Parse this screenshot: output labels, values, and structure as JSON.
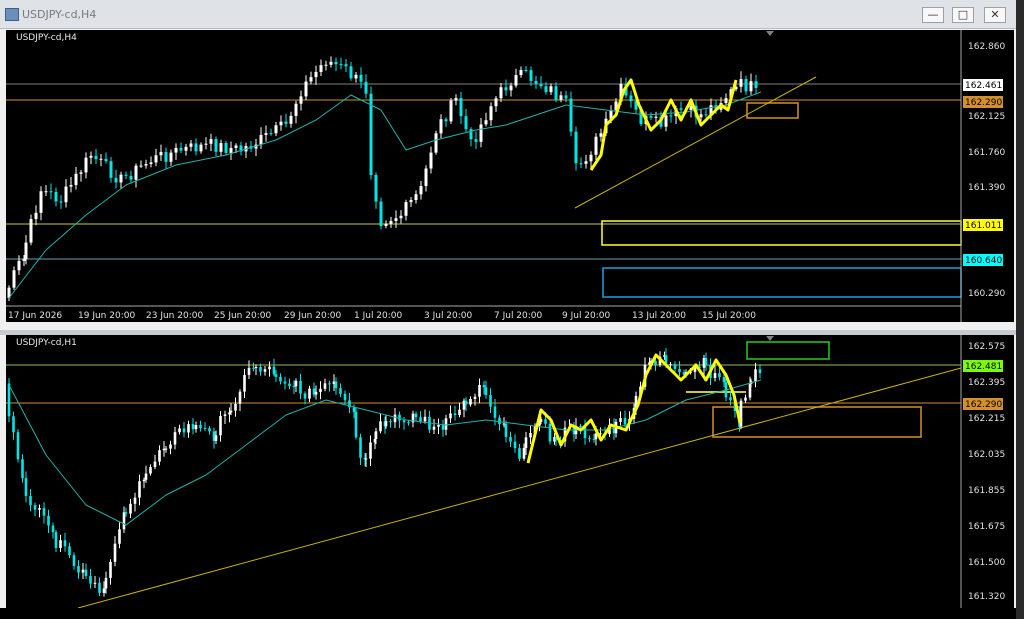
{
  "window": {
    "title": "USDJPY-cd,H4",
    "minimize_icon": "minimize-icon",
    "restore_icon": "restore-icon",
    "close_icon": "close-icon"
  },
  "colors": {
    "background": "#000000",
    "bull": "#ffffff",
    "bear": "#00e5e5",
    "ma": "#20b2aa",
    "yellow_line": "#ffd700",
    "orange_line": "#d4902a",
    "cyan_box": "#1ea0e0",
    "green_box": "#22cc22"
  },
  "top_chart": {
    "label": "USDJPY-cd,H4",
    "y_ticks": [
      "162.860",
      "162.125",
      "161.760",
      "161.390",
      "160.290"
    ],
    "price_tags": [
      {
        "text": "162.461",
        "style": "white"
      },
      {
        "text": "162.290",
        "style": "orange"
      },
      {
        "text": "161.011",
        "style": "yellow"
      },
      {
        "text": "160.640",
        "style": "cyan"
      }
    ],
    "x_ticks": [
      "17 Jun 2026",
      "19 Jun 20:00",
      "23 Jun 20:00",
      "25 Jun 20:00",
      "29 Jun 20:00",
      "1 Jul 20:00",
      "3 Jul 20:00",
      "7 Jul 20:00",
      "9 Jul 20:00",
      "13 Jul 20:00",
      "15 Jul 20:00"
    ]
  },
  "bottom_chart": {
    "label": "USDJPY-cd,H1",
    "y_ticks": [
      "162.575",
      "162.395",
      "162.215",
      "162.035",
      "161.855",
      "161.675",
      "161.500",
      "161.320"
    ],
    "price_tags": [
      {
        "text": "162.481",
        "style": "green"
      },
      {
        "text": "162.290",
        "style": "orange"
      }
    ]
  }
}
